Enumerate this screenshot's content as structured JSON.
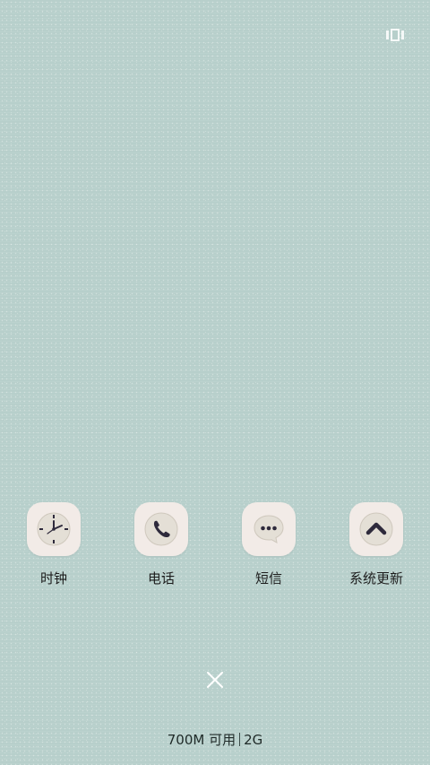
{
  "top_bar": {
    "recents_icon": "recents-layout-icon"
  },
  "recent_apps": [
    {
      "label": "时钟",
      "icon": "clock-icon"
    },
    {
      "label": "电话",
      "icon": "phone-icon"
    },
    {
      "label": "短信",
      "icon": "message-icon"
    },
    {
      "label": "系统更新",
      "icon": "system-update-icon"
    }
  ],
  "controls": {
    "clear_icon": "close-icon"
  },
  "memory": {
    "available": "700M 可用",
    "total": "2G"
  },
  "colors": {
    "background": "#b7cfcb",
    "icon_tile": "#f2ebe7",
    "icon_glyph": "#2e2a3c"
  }
}
